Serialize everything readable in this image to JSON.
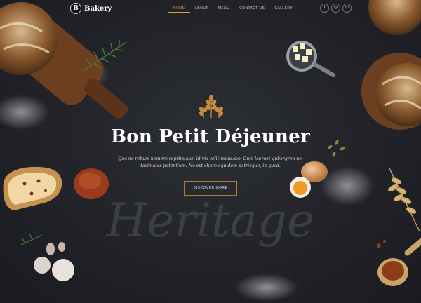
{
  "header": {
    "logo_badge": "B",
    "logo_text": "Bakery",
    "nav": [
      "HOME",
      "ABOUT",
      "MENU",
      "CONTACT US",
      "GALLERY"
    ],
    "social": [
      "f",
      "◎",
      "▭"
    ]
  },
  "hero": {
    "title": "Bon Petit Déjeuner",
    "subtitle_line1": "Quo no rebum homero reprimique, id vix velit recusabo. Cum laoreet gubergren ne,",
    "subtitle_line2": "tacimates petentium. No est choro equidem patrioque, in quod.",
    "cta_label": "DISCOVER MORE",
    "watermark": "Heritage"
  },
  "colors": {
    "accent": "#d29a4e",
    "background": "#23252b"
  }
}
